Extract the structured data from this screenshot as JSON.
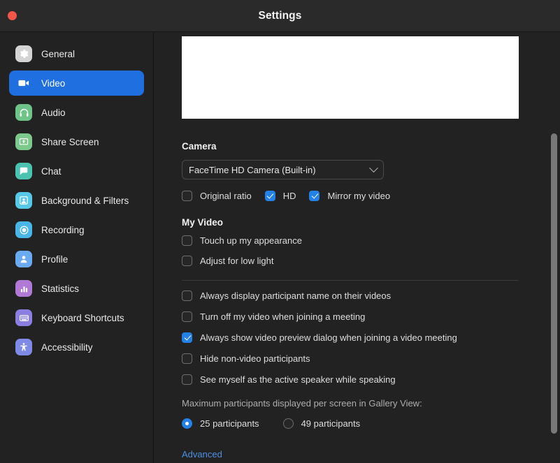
{
  "window": {
    "title": "Settings",
    "close_button": "close",
    "accent_color": "#2481e8",
    "active_nav_color": "#1f6fe0"
  },
  "sidebar": {
    "items": [
      {
        "label": "General",
        "icon": "gear-icon",
        "color": "#d4d4d4",
        "active": false
      },
      {
        "label": "Video",
        "icon": "video-camera-icon",
        "color": "#1f6fe0",
        "active": true
      },
      {
        "label": "Audio",
        "icon": "headphones-icon",
        "color": "#6fc48a",
        "active": false
      },
      {
        "label": "Share Screen",
        "icon": "share-screen-icon",
        "color": "#7bc98d",
        "active": false
      },
      {
        "label": "Chat",
        "icon": "chat-bubble-icon",
        "color": "#4cc2b0",
        "active": false
      },
      {
        "label": "Background & Filters",
        "icon": "background-filter-icon",
        "color": "#57c8e8",
        "active": false
      },
      {
        "label": "Recording",
        "icon": "record-icon",
        "color": "#4ab6e8",
        "active": false
      },
      {
        "label": "Profile",
        "icon": "person-icon",
        "color": "#6aaaf0",
        "active": false
      },
      {
        "label": "Statistics",
        "icon": "bar-chart-icon",
        "color": "#b079d6",
        "active": false
      },
      {
        "label": "Keyboard Shortcuts",
        "icon": "keyboard-icon",
        "color": "#8a7fe0",
        "active": false
      },
      {
        "label": "Accessibility",
        "icon": "accessibility-icon",
        "color": "#7f8ae6",
        "active": false
      }
    ]
  },
  "main": {
    "video_preview": {
      "name": "video-preview"
    },
    "camera": {
      "heading": "Camera",
      "selected_device": "FaceTime HD Camera (Built-in)",
      "options": [
        {
          "label": "Original ratio",
          "checked": false
        },
        {
          "label": "HD",
          "checked": true
        },
        {
          "label": "Mirror my video",
          "checked": true
        }
      ]
    },
    "my_video": {
      "heading": "My Video",
      "options": [
        {
          "label": "Touch up my appearance",
          "checked": false
        },
        {
          "label": "Adjust for low light",
          "checked": false
        }
      ]
    },
    "meeting_options": [
      {
        "label": "Always display participant name on their videos",
        "checked": false
      },
      {
        "label": "Turn off my video when joining a meeting",
        "checked": false
      },
      {
        "label": "Always show video preview dialog when joining a video meeting",
        "checked": true
      },
      {
        "label": "Hide non-video participants",
        "checked": false
      },
      {
        "label": "See myself as the active speaker while speaking",
        "checked": false
      }
    ],
    "gallery": {
      "hint": "Maximum participants displayed per screen in Gallery View:",
      "choices": [
        {
          "label": "25 participants",
          "selected": true
        },
        {
          "label": "49 participants",
          "selected": false
        }
      ]
    },
    "advanced_label": "Advanced"
  }
}
